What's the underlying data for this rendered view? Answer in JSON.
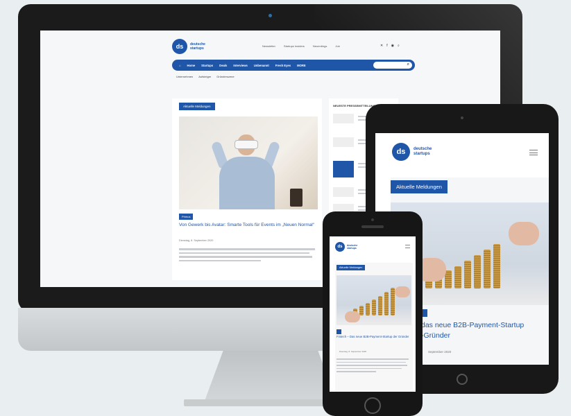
{
  "brand": {
    "logo_letters": "ds",
    "logo_name": "deutsche startups",
    "accent": "#1f56a8"
  },
  "desktop": {
    "top_links": [
      "Newsletter",
      "Startups Insiders",
      "Neuerdings",
      "Job"
    ],
    "nav_items": [
      "Home",
      "Startups",
      "Deals",
      "Interviews",
      "Unbenannt",
      "Fresh Eyes",
      "MORE"
    ],
    "search_placeholder": "Suche",
    "subnav": [
      "Unternehmen",
      "Aufsteiger",
      "Gründerszene"
    ],
    "section_label": "Aktuelle Meldungen",
    "article": {
      "tag": "Primus",
      "headline": "Von Gewerk bis Avatar: Smarte Tools für Events im „Neuen Normal“",
      "meta": "Dienstag, 8. September 2020"
    },
    "sidebar_title": "NEUESTE PRESSEMITTEILUNGEN"
  },
  "tablet": {
    "section_label": "Aktuelle Meldungen",
    "headline": "das neue B2B-Payment-Startup\n-Gründer",
    "meta": "September 2020"
  },
  "phone": {
    "section_label": "Aktuelle Meldungen",
    "headline": "Fintech – Das neue B2B-Payment-Startup der Gründer",
    "meta": "Dienstag, 8. September 2020"
  }
}
